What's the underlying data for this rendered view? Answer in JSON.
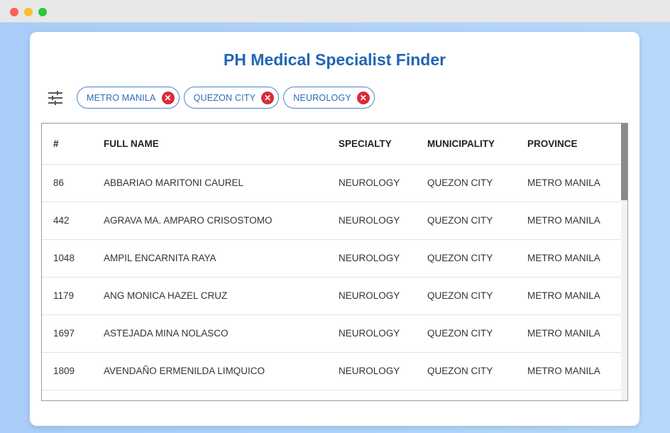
{
  "app": {
    "title": "PH Medical Specialist Finder"
  },
  "filters": {
    "icon": "filter-sliders-icon",
    "chips": [
      {
        "label": "METRO MANILA"
      },
      {
        "label": "QUEZON CITY"
      },
      {
        "label": "NEUROLOGY"
      }
    ],
    "chip_remove_symbol": "✕"
  },
  "table": {
    "columns": [
      "#",
      "FULL NAME",
      "SPECIALTY",
      "MUNICIPALITY",
      "PROVINCE"
    ],
    "rows": [
      [
        "86",
        "ABBARIAO MARITONI CAUREL",
        "NEUROLOGY",
        "QUEZON CITY",
        "METRO MANILA"
      ],
      [
        "442",
        "AGRAVA MA. AMPARO CRISOSTOMO",
        "NEUROLOGY",
        "QUEZON CITY",
        "METRO MANILA"
      ],
      [
        "1048",
        "AMPIL ENCARNITA RAYA",
        "NEUROLOGY",
        "QUEZON CITY",
        "METRO MANILA"
      ],
      [
        "1179",
        "ANG MONICA HAZEL CRUZ",
        "NEUROLOGY",
        "QUEZON CITY",
        "METRO MANILA"
      ],
      [
        "1697",
        "ASTEJADA MINA NOLASCO",
        "NEUROLOGY",
        "QUEZON CITY",
        "METRO MANILA"
      ],
      [
        "1809",
        "AVENDAÑO ERMENILDA LIMQUICO",
        "NEUROLOGY",
        "QUEZON CITY",
        "METRO MANILA"
      ],
      [
        "",
        "",
        "",
        "",
        ""
      ]
    ]
  },
  "colors": {
    "accent": "#2166b5",
    "chip_remove": "#d62d3a"
  }
}
